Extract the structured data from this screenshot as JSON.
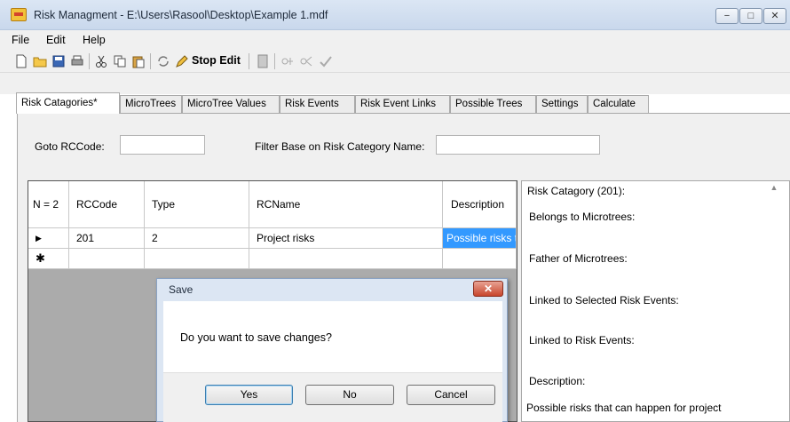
{
  "window": {
    "title": "Risk Managment - E:\\Users\\Rasool\\Desktop\\Example 1.mdf",
    "controls": [
      "−",
      "□",
      "✕"
    ]
  },
  "menu": [
    "File",
    "Edit",
    "Help"
  ],
  "toolbar": {
    "stop_edit_label": "Stop Edit"
  },
  "tabs": [
    {
      "label": "Risk Catagories*",
      "active": true
    },
    {
      "label": "MicroTrees"
    },
    {
      "label": "MicroTree Values"
    },
    {
      "label": "Risk Events"
    },
    {
      "label": "Risk Event Links"
    },
    {
      "label": "Possible Trees"
    },
    {
      "label": "Settings"
    },
    {
      "label": "Calculate"
    }
  ],
  "filters": {
    "goto_label": "Goto RCCode:",
    "goto_value": "",
    "filter_label": "Filter Base on Risk Category Name:",
    "filter_value": ""
  },
  "grid": {
    "row_header": "N = 2",
    "columns": [
      "RCCode",
      "Type",
      "RCName",
      "Description"
    ],
    "rows": [
      {
        "indicator": "▶",
        "cells": [
          "201",
          "2",
          "Project risks",
          "Possible risks t"
        ]
      },
      {
        "indicator": "✱",
        "cells": [
          "",
          "",
          "",
          ""
        ]
      }
    ]
  },
  "info": {
    "title": "Risk Catagory (201):",
    "belongs": "Belongs to Microtrees:",
    "father": "Father of Microtrees:",
    "linked_selected": "Linked to Selected Risk Events:",
    "linked": "Linked to Risk Events:",
    "description_label": "Description:",
    "description_value": "Possible risks that can happen for project"
  },
  "dialog": {
    "title": "Save",
    "close": "✕",
    "message": "Do you want to save changes?",
    "yes": "Yes",
    "no": "No",
    "cancel": "Cancel"
  },
  "colors": {
    "selection": "#3399ff",
    "dialog_close": "#c8452c",
    "titlebar": "#dbe6f4"
  }
}
